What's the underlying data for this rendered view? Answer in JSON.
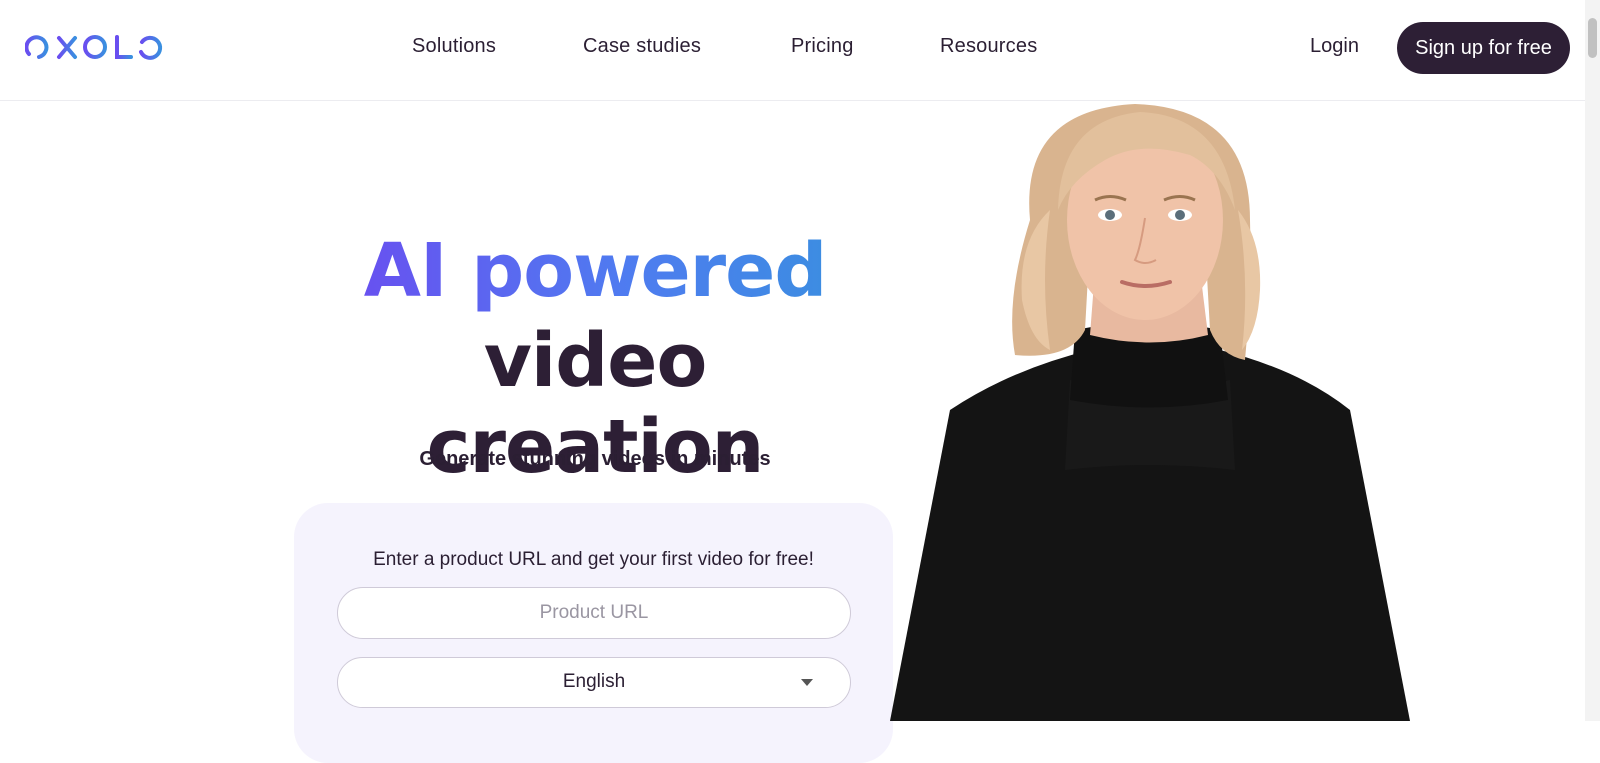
{
  "brand": {
    "logo_text": "OXOLO",
    "accent_start": "#6a4df0",
    "accent_end": "#3a8fe0",
    "dark": "#2d1f35"
  },
  "nav": {
    "items": [
      {
        "label": "Solutions"
      },
      {
        "label": "Case studies"
      },
      {
        "label": "Pricing"
      },
      {
        "label": "Resources"
      }
    ],
    "login_label": "Login",
    "signup_label": "Sign up for free"
  },
  "hero": {
    "headline_line1": "AI powered",
    "headline_line2": "video creation",
    "subheadline": "Generate stunning videos in minutes",
    "card": {
      "prompt": "Enter a product URL and get your first video for free!",
      "url_placeholder": "Product URL",
      "language_selected": "English"
    }
  },
  "presenter_image": {
    "description_icon": "presenter-avatar"
  }
}
